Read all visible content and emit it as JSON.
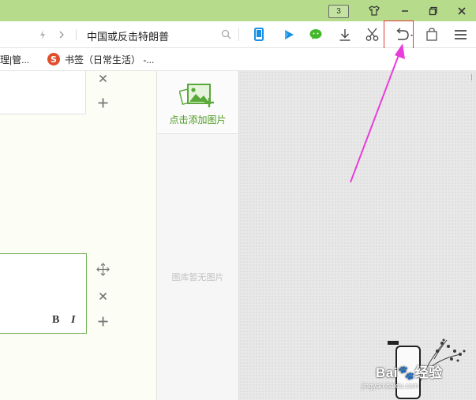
{
  "titlebar": {
    "tab_count": "3",
    "buttons": [
      "skin-icon",
      "minimize-icon",
      "maximize-icon",
      "close-icon"
    ]
  },
  "navbar": {
    "address_text": "中国或反击特朗普",
    "icons": [
      "lightning-icon",
      "chevron-right-icon",
      "search-icon",
      "phone-icon",
      "video-play-icon",
      "wechat-icon",
      "download-icon",
      "scissors-icon",
      "undo-icon",
      "bag-icon",
      "menu-icon"
    ]
  },
  "bookmarks": {
    "item1": "理|管...",
    "item2": "书签（日常生活）  -..."
  },
  "editor": {
    "bold_label": "B",
    "italic_label": "I"
  },
  "gallery": {
    "add_image_label": "点击添加图片",
    "empty_label": "图库暂无图片"
  },
  "watermark": {
    "text": "Bai🐾经验",
    "sub": "jingyan.baidu.com"
  },
  "colors": {
    "title_green": "#b6dc8b",
    "accent_green": "#4d9b22",
    "phone_blue": "#1a8fe3",
    "highlight_red": "#e23a3a",
    "arrow_magenta": "#e83ddc"
  }
}
